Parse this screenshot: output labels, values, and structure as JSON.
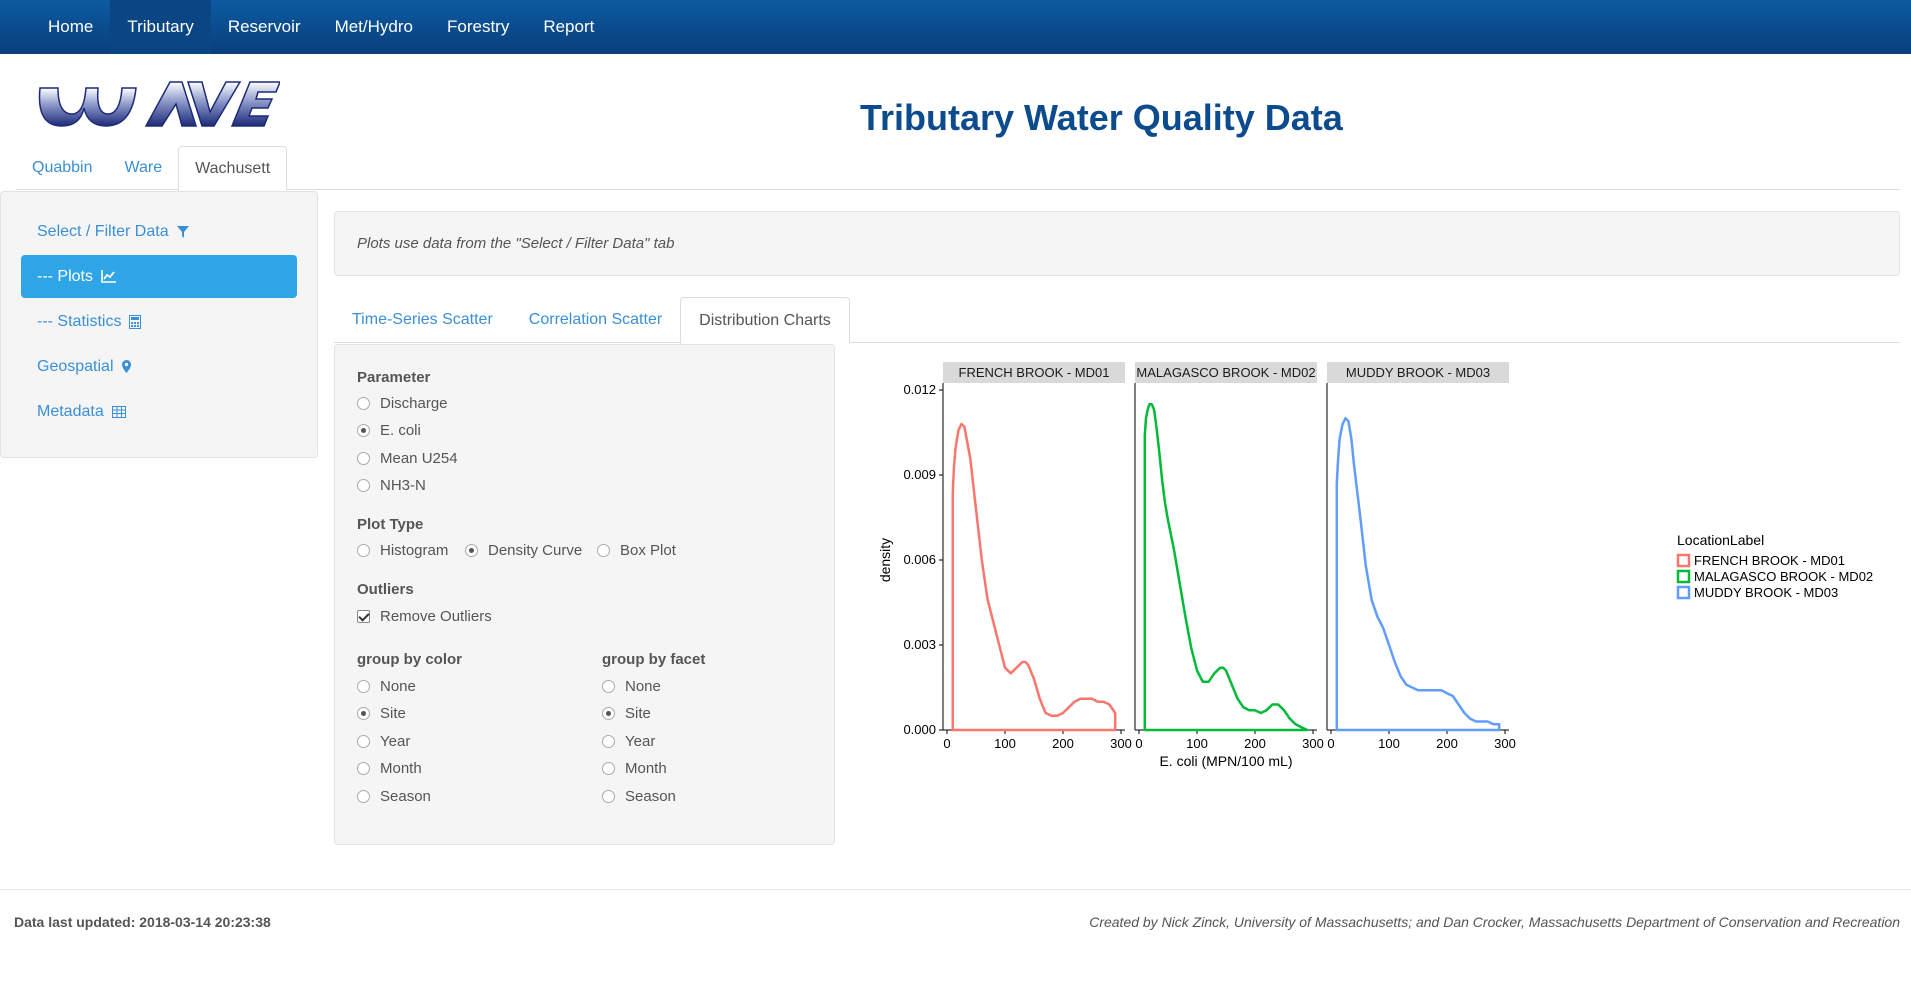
{
  "nav": {
    "items": [
      {
        "label": "Home"
      },
      {
        "label": "Tributary"
      },
      {
        "label": "Reservoir"
      },
      {
        "label": "Met/Hydro"
      },
      {
        "label": "Forestry"
      },
      {
        "label": "Report"
      }
    ],
    "active": "Tributary"
  },
  "header": {
    "logo_text": "WAVE",
    "title": "Tributary Water Quality Data"
  },
  "reservoir_tabs": [
    {
      "label": "Quabbin"
    },
    {
      "label": "Ware"
    },
    {
      "label": "Wachusett"
    }
  ],
  "sidebar": {
    "items": [
      {
        "label": "Select / Filter Data",
        "icon": "filter-icon"
      },
      {
        "label": "--- Plots",
        "icon": "line-chart-icon"
      },
      {
        "label": "--- Statistics",
        "icon": "calculator-icon"
      },
      {
        "label": "Geospatial",
        "icon": "map-marker-icon"
      },
      {
        "label": "Metadata",
        "icon": "table-icon"
      }
    ]
  },
  "info_text": "Plots use data from the \"Select / Filter Data\" tab",
  "chart_tabs": [
    {
      "label": "Time-Series Scatter"
    },
    {
      "label": "Correlation Scatter"
    },
    {
      "label": "Distribution Charts"
    }
  ],
  "controls": {
    "parameter": {
      "label": "Parameter",
      "options": [
        "Discharge",
        "E. coli",
        "Mean U254",
        "NH3-N"
      ],
      "selected": "E. coli"
    },
    "plot_type": {
      "label": "Plot Type",
      "options": [
        "Histogram",
        "Density Curve",
        "Box Plot"
      ],
      "selected": "Density Curve"
    },
    "outliers": {
      "label": "Outliers",
      "checkbox_label": "Remove Outliers",
      "checked": true
    },
    "group_color": {
      "label": "group by color",
      "options": [
        "None",
        "Site",
        "Year",
        "Month",
        "Season"
      ],
      "selected": "Site"
    },
    "group_facet": {
      "label": "group by facet",
      "options": [
        "None",
        "Site",
        "Year",
        "Month",
        "Season"
      ],
      "selected": "Site"
    }
  },
  "chart_data": {
    "type": "line",
    "subtype": "density",
    "xlabel": "E. coli (MPN/100 mL)",
    "ylabel": "density",
    "xlim": [
      0,
      300
    ],
    "ylim": [
      0,
      0.012
    ],
    "x_ticks": [
      0,
      100,
      200,
      300
    ],
    "y_ticks": [
      0.0,
      0.003,
      0.006,
      0.009,
      0.012
    ],
    "y_tick_labels": [
      "0.000",
      "0.003",
      "0.006",
      "0.009",
      "0.012"
    ],
    "legend": {
      "title": "LocationLabel",
      "placement": "right"
    },
    "facets": [
      {
        "name": "FRENCH BROOK - MD01",
        "color": "#f8766d",
        "x": [
          10,
          12,
          15,
          20,
          25,
          30,
          40,
          50,
          60,
          70,
          80,
          90,
          100,
          110,
          120,
          130,
          135,
          140,
          150,
          160,
          170,
          180,
          190,
          200,
          210,
          220,
          230,
          240,
          250,
          260,
          270,
          280,
          290
        ],
        "values": [
          0.0084,
          0.0093,
          0.01,
          0.0106,
          0.0108,
          0.0107,
          0.0096,
          0.0078,
          0.006,
          0.0046,
          0.0038,
          0.003,
          0.0022,
          0.002,
          0.0022,
          0.0024,
          0.0024,
          0.0023,
          0.0018,
          0.0011,
          0.0006,
          0.0005,
          0.0005,
          0.0006,
          0.0008,
          0.001,
          0.0011,
          0.0011,
          0.0011,
          0.001,
          0.001,
          0.0009,
          0.0006
        ]
      },
      {
        "name": "MALAGASCO BROOK - MD02",
        "color": "#00ba38",
        "x": [
          10,
          12,
          15,
          18,
          22,
          26,
          30,
          35,
          40,
          45,
          50,
          60,
          70,
          80,
          90,
          100,
          110,
          120,
          130,
          140,
          145,
          150,
          160,
          170,
          180,
          190,
          200,
          210,
          220,
          230,
          240,
          250,
          260,
          270,
          280,
          290
        ],
        "values": [
          0.0104,
          0.011,
          0.0113,
          0.0115,
          0.0115,
          0.0113,
          0.0107,
          0.0098,
          0.0088,
          0.008,
          0.0074,
          0.0064,
          0.0052,
          0.004,
          0.0029,
          0.0021,
          0.0017,
          0.0017,
          0.002,
          0.0022,
          0.0022,
          0.0021,
          0.0016,
          0.0011,
          0.0008,
          0.0007,
          0.0007,
          0.0006,
          0.0007,
          0.0009,
          0.0009,
          0.0007,
          0.0004,
          0.0002,
          0.0001,
          0.0
        ]
      },
      {
        "name": "MUDDY BROOK - MD03",
        "color": "#619cff",
        "x": [
          10,
          12,
          15,
          20,
          25,
          30,
          35,
          40,
          50,
          60,
          70,
          80,
          90,
          100,
          110,
          120,
          130,
          140,
          150,
          160,
          170,
          180,
          190,
          200,
          210,
          220,
          230,
          240,
          250,
          260,
          270,
          280,
          290
        ],
        "values": [
          0.0087,
          0.0095,
          0.0103,
          0.0108,
          0.011,
          0.0109,
          0.0103,
          0.0093,
          0.0076,
          0.0058,
          0.0046,
          0.004,
          0.0036,
          0.003,
          0.0024,
          0.0019,
          0.0016,
          0.0015,
          0.0014,
          0.0014,
          0.0014,
          0.0014,
          0.0014,
          0.0013,
          0.0012,
          0.0009,
          0.0006,
          0.0004,
          0.0003,
          0.0003,
          0.0003,
          0.0002,
          0.0002
        ]
      }
    ]
  },
  "footer": {
    "updated": "Data last updated: 2018-03-14 20:23:38",
    "credits": "Created by Nick Zinck, University of Massachusetts; and Dan Crocker, Massachusetts Department of Conservation and Recreation"
  }
}
